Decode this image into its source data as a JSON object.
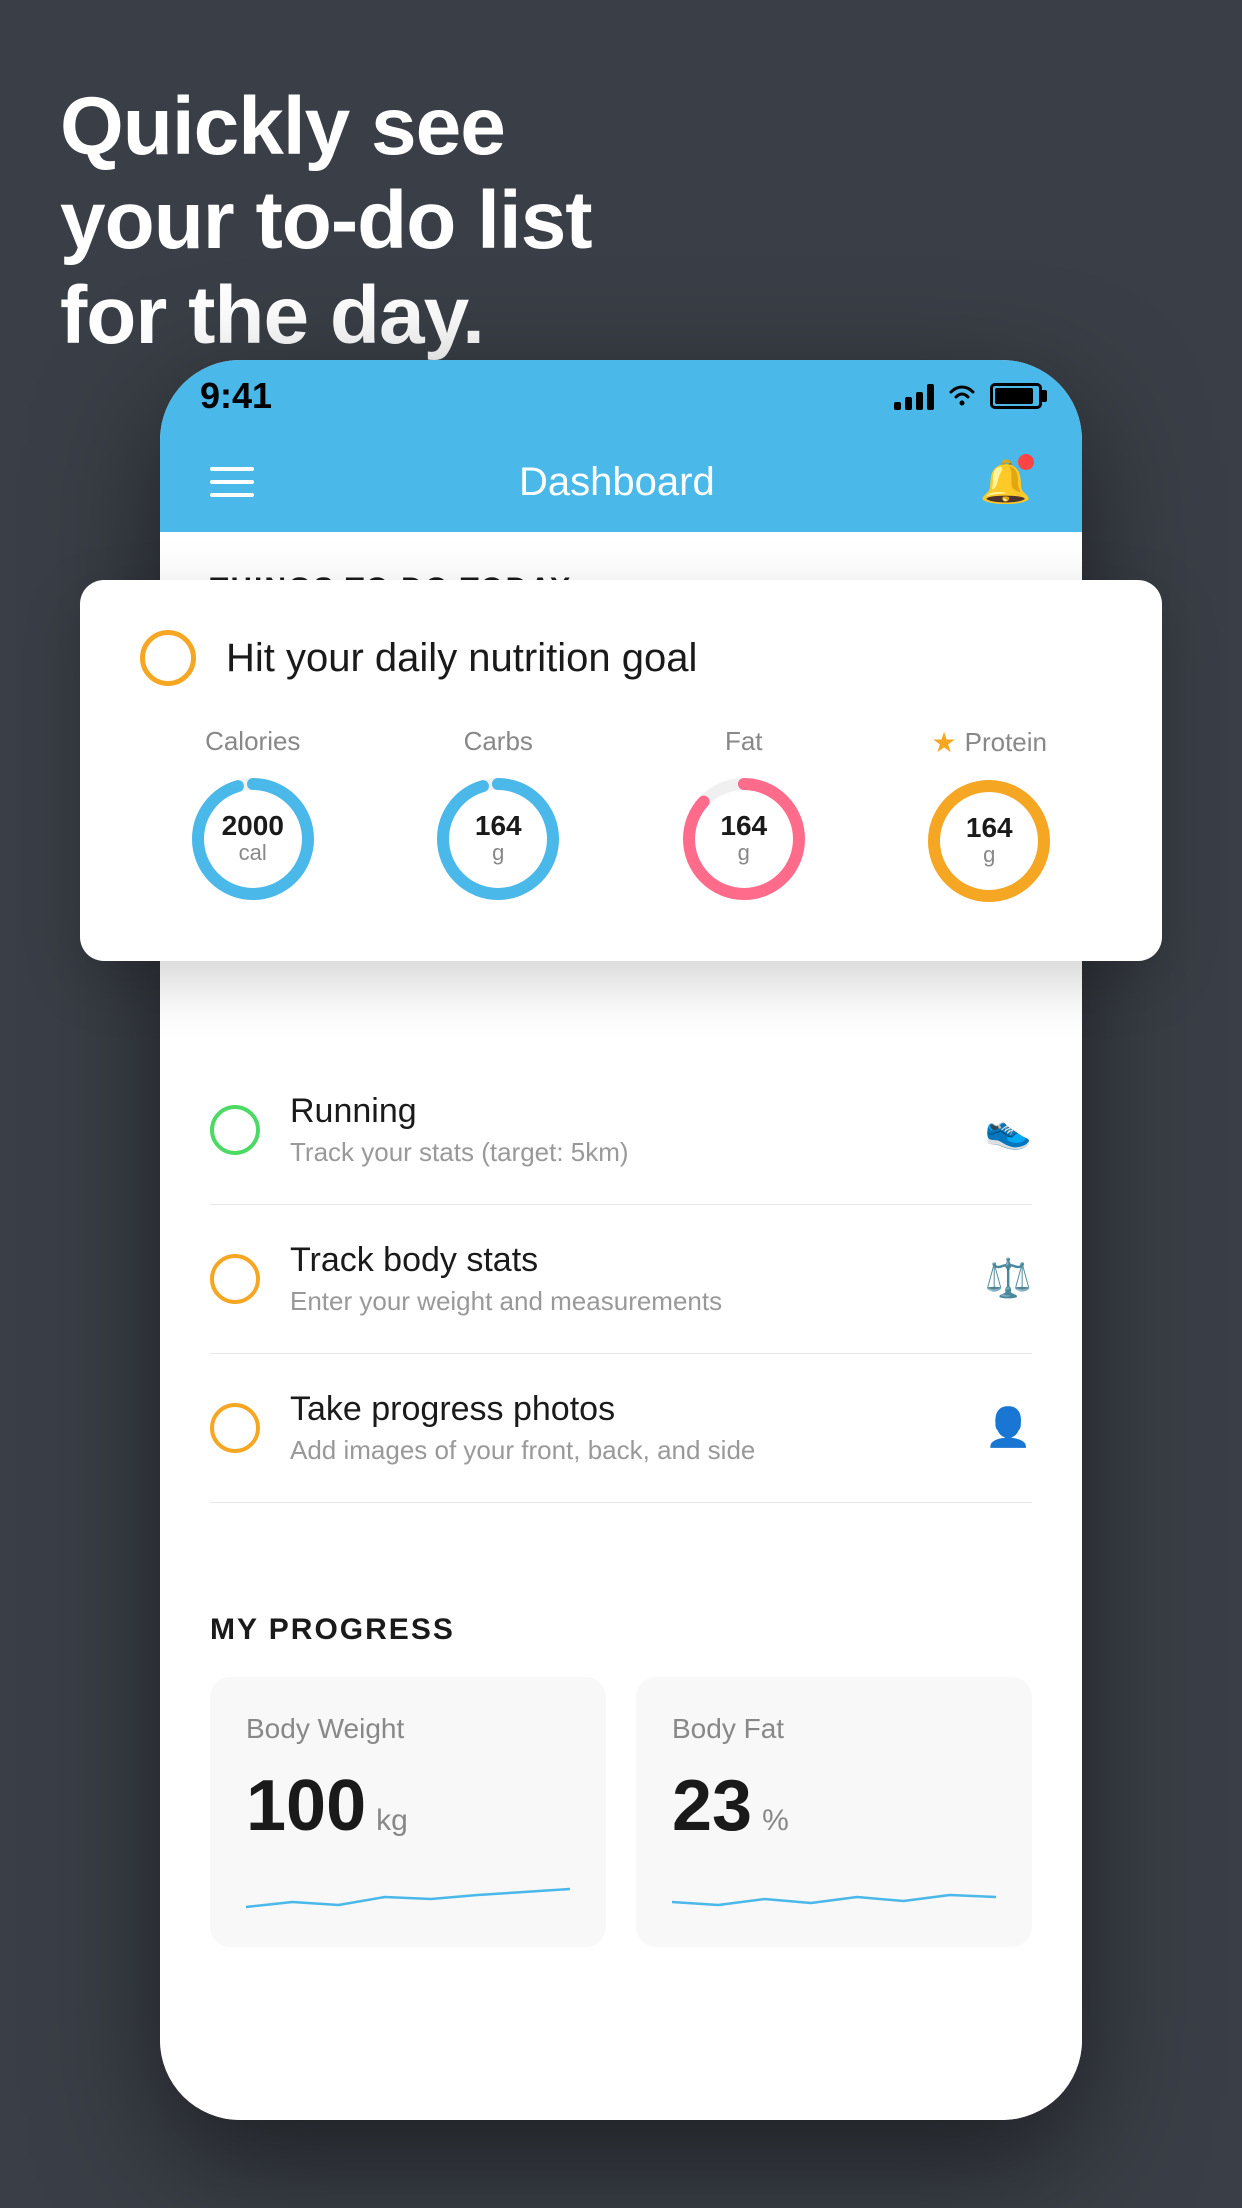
{
  "hero": {
    "line1": "Quickly see",
    "line2": "your to-do list",
    "line3": "for the day."
  },
  "statusBar": {
    "time": "9:41"
  },
  "header": {
    "title": "Dashboard"
  },
  "sectionHeader": "THINGS TO DO TODAY",
  "floatingCard": {
    "circleColor": "#f5a623",
    "title": "Hit your daily nutrition goal",
    "nutrition": [
      {
        "label": "Calories",
        "value": "2000",
        "unit": "cal",
        "color": "blue",
        "starred": false
      },
      {
        "label": "Carbs",
        "value": "164",
        "unit": "g",
        "color": "blue",
        "starred": false
      },
      {
        "label": "Fat",
        "value": "164",
        "unit": "g",
        "color": "pink",
        "starred": false
      },
      {
        "label": "Protein",
        "value": "164",
        "unit": "g",
        "color": "yellow",
        "starred": true
      }
    ]
  },
  "todoItems": [
    {
      "circleType": "green",
      "title": "Running",
      "subtitle": "Track your stats (target: 5km)",
      "icon": "shoe"
    },
    {
      "circleType": "yellow",
      "title": "Track body stats",
      "subtitle": "Enter your weight and measurements",
      "icon": "scale"
    },
    {
      "circleType": "yellow",
      "title": "Take progress photos",
      "subtitle": "Add images of your front, back, and side",
      "icon": "person"
    }
  ],
  "myProgress": {
    "sectionTitle": "MY PROGRESS",
    "cards": [
      {
        "title": "Body Weight",
        "value": "100",
        "unit": "kg"
      },
      {
        "title": "Body Fat",
        "value": "23",
        "unit": "%"
      }
    ]
  }
}
